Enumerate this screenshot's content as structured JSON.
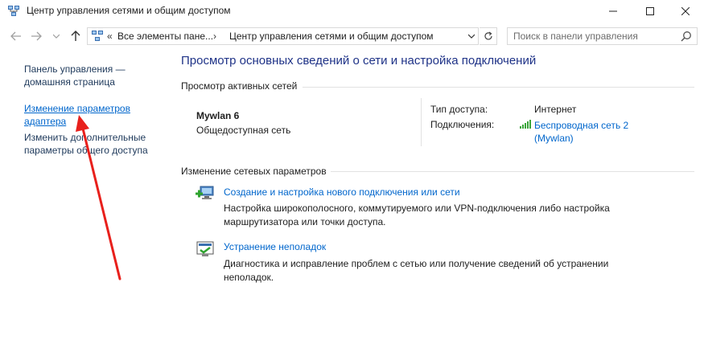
{
  "window": {
    "title": "Центр управления сетями и общим доступом",
    "icon": "network-center-icon"
  },
  "address": {
    "overflow": "«",
    "segments": [
      "Все элементы пане...",
      "Центр управления сетями и общим доступом"
    ],
    "separator": "›"
  },
  "search": {
    "placeholder": "Поиск в панели управления"
  },
  "sidebar": {
    "home_line1": "Панель управления —",
    "home_line2": "домашняя страница",
    "adapter_line1": "Изменение параметров",
    "adapter_line2": "адаптера",
    "sharing_line1": "Изменить дополнительные",
    "sharing_line2": "параметры общего доступа"
  },
  "main": {
    "title": "Просмотр основных сведений о сети и настройка подключений",
    "active_networks_header": "Просмотр активных сетей",
    "network": {
      "name": "Mywlan  6",
      "type": "Общедоступная сеть",
      "access_label": "Тип доступа:",
      "access_value": "Интернет",
      "connections_label": "Подключения:",
      "connection_line1": "Беспроводная сеть 2",
      "connection_line2": "(Mywlan)"
    },
    "change_header": "Изменение сетевых параметров",
    "tasks": [
      {
        "link": "Создание и настройка нового подключения или сети",
        "desc_line1": "Настройка широкополосного, коммутируемого или VPN-подключения либо настройка",
        "desc_line2": "маршрутизатора или точки доступа."
      },
      {
        "link": "Устранение неполадок",
        "desc_line1": "Диагностика и исправление проблем с сетью или получение сведений об устранении",
        "desc_line2": "неполадок."
      }
    ]
  },
  "colors": {
    "link": "#0066cc",
    "title": "#1e3287",
    "annotation_arrow": "#e8201c"
  }
}
